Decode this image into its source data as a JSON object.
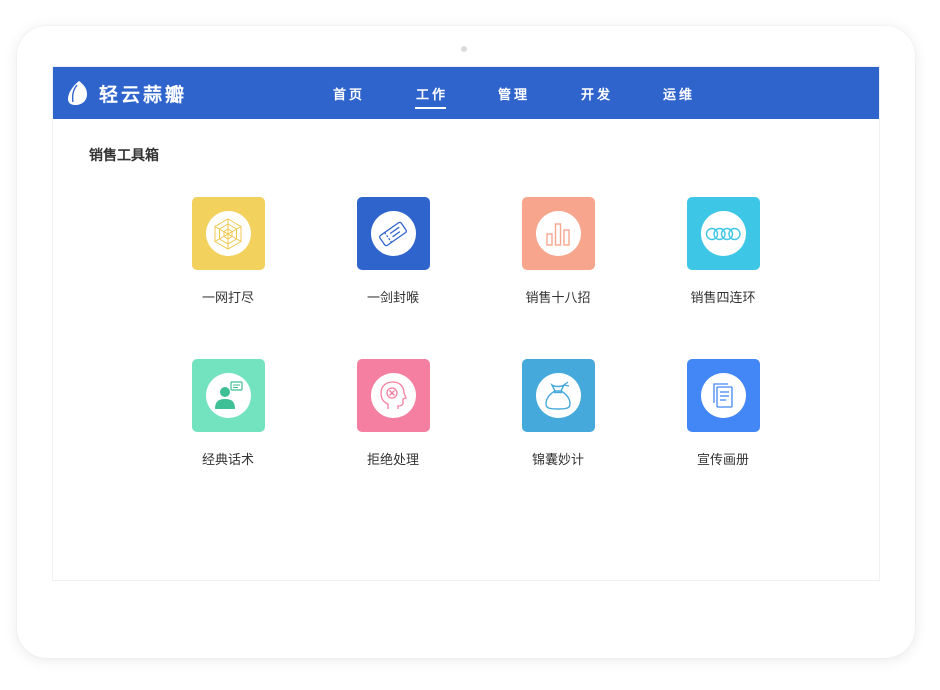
{
  "app": {
    "name": "轻云蒜瓣",
    "logo_icon": "garlic-clove-icon"
  },
  "nav": {
    "items": [
      {
        "label": "首页",
        "active": false
      },
      {
        "label": "工作",
        "active": true
      },
      {
        "label": "管理",
        "active": false
      },
      {
        "label": "开发",
        "active": false
      },
      {
        "label": "运维",
        "active": false
      }
    ]
  },
  "colors": {
    "navbar": "#3064cd",
    "background": "#ffffff"
  },
  "main": {
    "section_title": "销售工具箱",
    "tools": [
      {
        "label": "一网打尽",
        "icon": "web-net-icon",
        "color": "#f2d15c"
      },
      {
        "label": "一剑封喉",
        "icon": "ticket-icon",
        "color": "#3064cd"
      },
      {
        "label": "销售十八招",
        "icon": "bar-chart-icon",
        "color": "#f8a58e"
      },
      {
        "label": "销售四连环",
        "icon": "linked-rings-icon",
        "color": "#3ec6e6"
      },
      {
        "label": "经典话术",
        "icon": "speaker-person-icon",
        "color": "#72e3be"
      },
      {
        "label": "拒绝处理",
        "icon": "head-reject-icon",
        "color": "#f57fa0"
      },
      {
        "label": "锦囊妙计",
        "icon": "money-bag-icon",
        "color": "#46a9dc"
      },
      {
        "label": "宣传画册",
        "icon": "brochure-icon",
        "color": "#4387f6"
      }
    ]
  }
}
